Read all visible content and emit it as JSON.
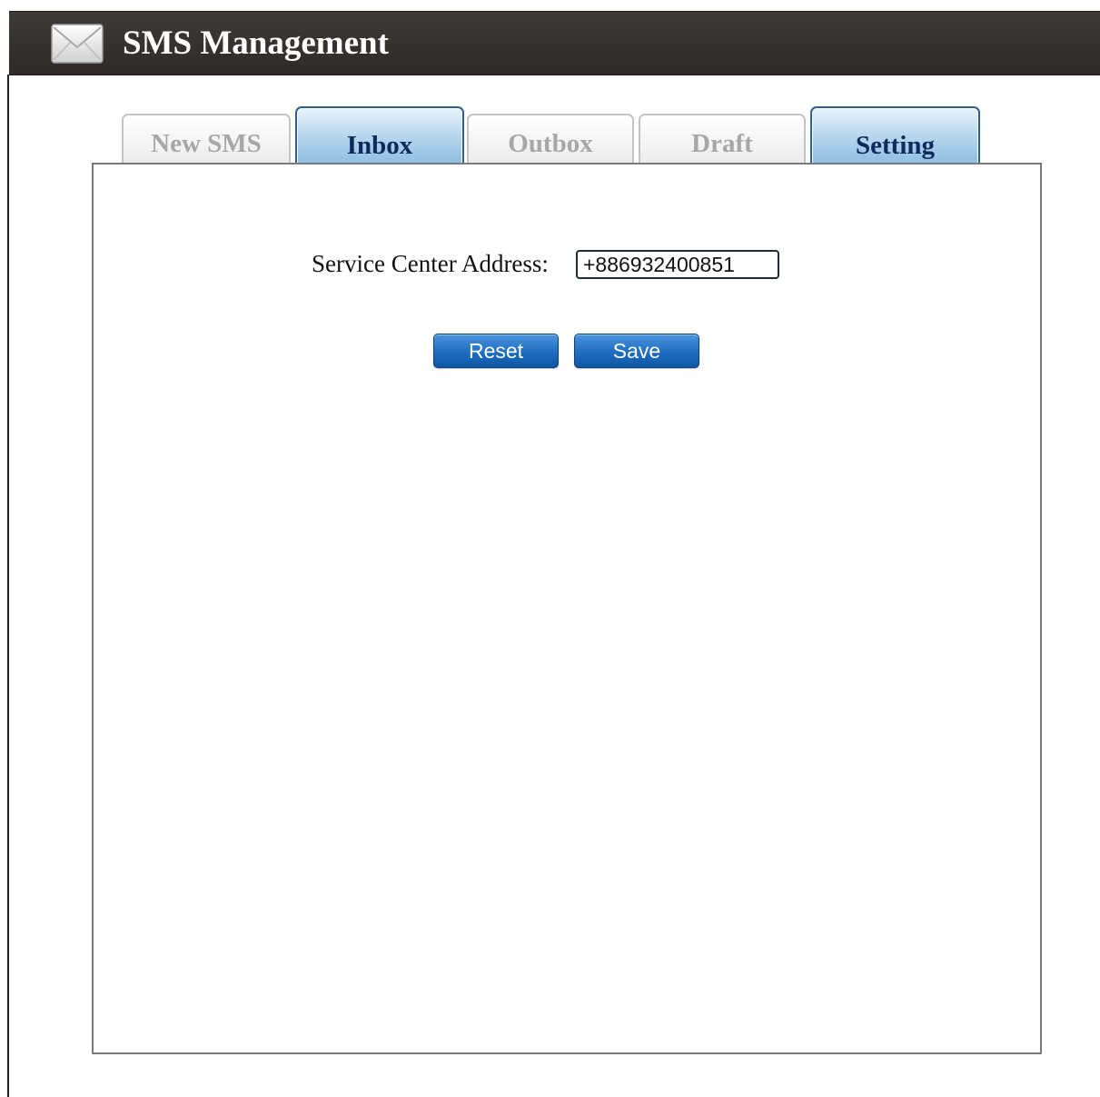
{
  "header": {
    "title": "SMS Management",
    "icon": "envelope-icon"
  },
  "tabs": [
    {
      "label": "New SMS",
      "active": false
    },
    {
      "label": "Inbox",
      "active": true
    },
    {
      "label": "Outbox",
      "active": false
    },
    {
      "label": "Draft",
      "active": false
    },
    {
      "label": "Setting",
      "active": true
    }
  ],
  "settings": {
    "service_center_label": "Service Center Address:",
    "service_center_value": "+886932400851"
  },
  "buttons": {
    "reset_label": "Reset",
    "save_label": "Save"
  },
  "colors": {
    "header_bg": "#3a3533",
    "active_tab": "#a9cdea",
    "button_blue": "#1f6ec0"
  }
}
